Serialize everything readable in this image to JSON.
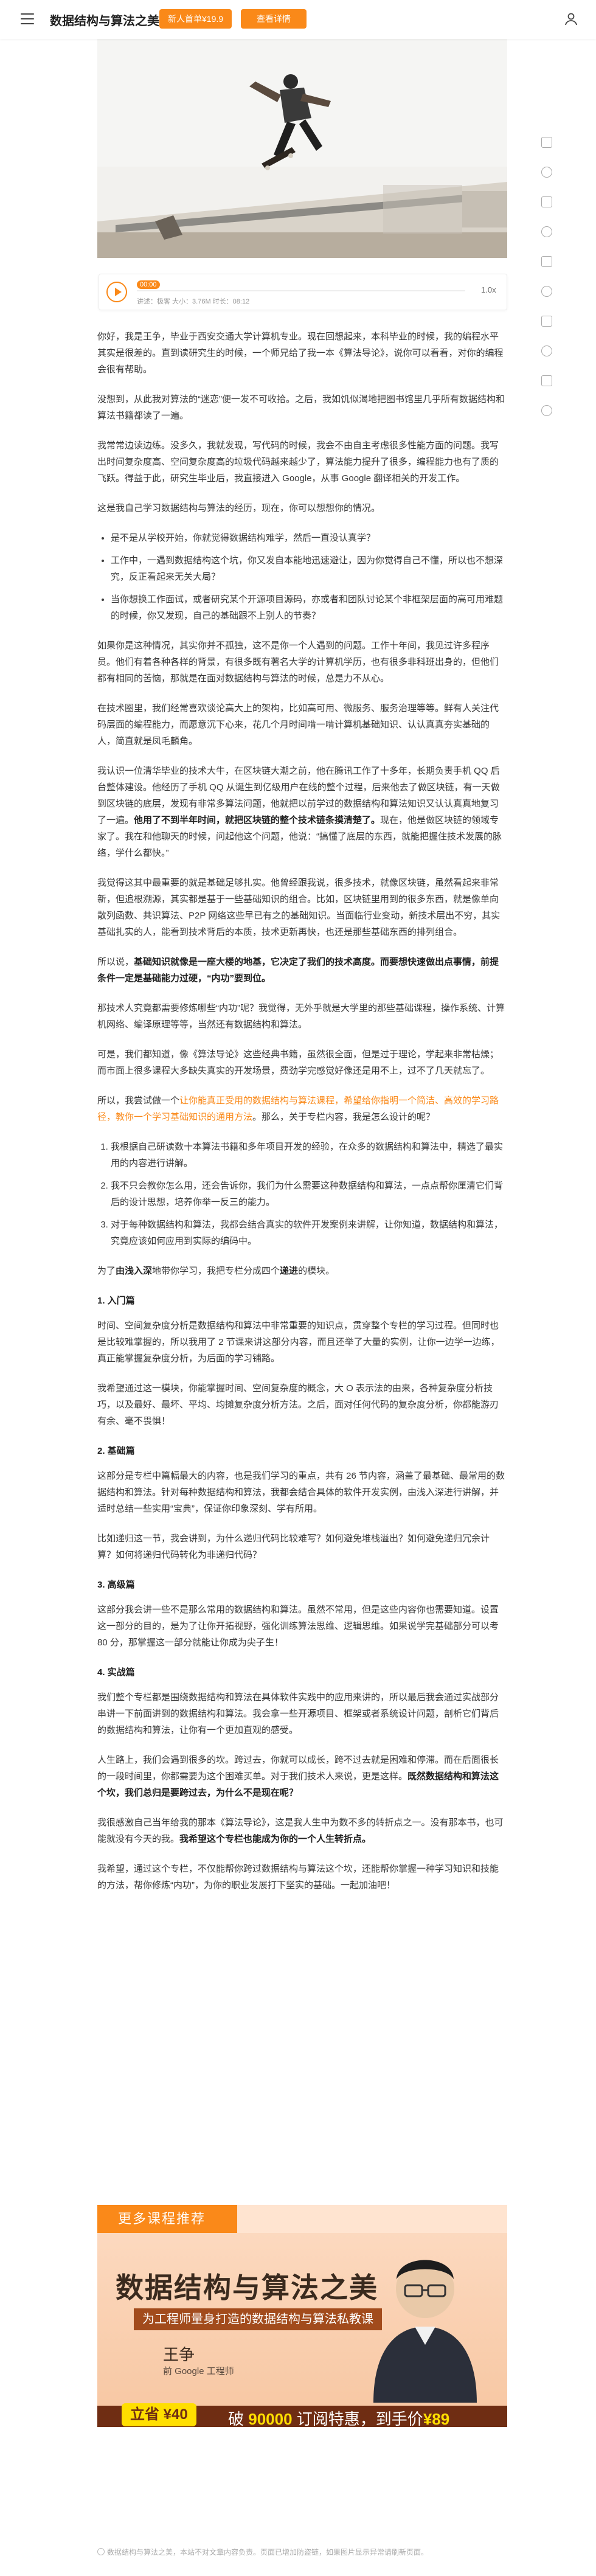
{
  "topbar": {
    "title": "数据结构与算法之美",
    "promo_badge": "新人首单¥19.9",
    "detail_button": "查看详情"
  },
  "audio": {
    "time_badge": "00:00",
    "meta": "讲述：极客  大小：3.76M  时长：08:12",
    "speed": "1.0x"
  },
  "article": {
    "p1": "你好，我是王争，毕业于西安交通大学计算机专业。现在回想起来，本科毕业的时候，我的编程水平其实是很差的。直到读研究生的时候，一个师兄给了我一本《算法导论》，说你可以看看，对你的编程会很有帮助。",
    "p2": "没想到，从此我对算法的“迷恋”便一发不可收拾。之后，我如饥似渴地把图书馆里几乎所有数据结构和算法书籍都读了一遍。",
    "p3": "我常常边读边练。没多久，我就发现，写代码的时候，我会不由自主考虑很多性能方面的问题。我写出时间复杂度高、空间复杂度高的垃圾代码越来越少了，算法能力提升了很多，编程能力也有了质的飞跃。得益于此，研究生毕业后，我直接进入 Google，从事 Google 翻译相关的开发工作。",
    "p4": "这是我自己学习数据结构与算法的经历，现在，你可以想想你的情况。",
    "bullets": [
      "是不是从学校开始，你就觉得数据结构难学，然后一直没认真学？",
      "工作中，一遇到数据结构这个坑，你又发自本能地迅速避让，因为你觉得自己不懂，所以也不想深究，反正看起来无关大局？",
      "当你想换工作面试，或者研究某个开源项目源码，亦或者和团队讨论某个非框架层面的高可用难题的时候，你又发现，自己的基础跟不上别人的节奏？"
    ],
    "p5": "如果你是这种情况，其实你并不孤独，这不是你一个人遇到的问题。工作十年间，我见过许多程序员。他们有着各种各样的背景，有很多既有著名大学的计算机学历，也有很多非科班出身的，但他们都有相同的苦恼，那就是在面对数据结构与算法的时候，总是力不从心。",
    "p6": "在技术圈里，我们经常喜欢谈论高大上的架构，比如高可用、微服务、服务治理等等。鲜有人关注代码层面的编程能力，而愿意沉下心来，花几个月时间啃一啃计算机基础知识、认认真真夯实基础的人，简直就是凤毛麟角。",
    "p7a": "我认识一位清华毕业的技术大牛，在区块链大潮之前，他在腾讯工作了十多年，长期负责手机 QQ 后台整体建设。他经历了手机 QQ 从诞生到亿级用户在线的整个过程，后来他去了做区块链，有一天做到区块链的底层，发现有非常多算法问题，他就把以前学过的数据结构和算法知识又认认真真地复习了一遍。",
    "p7b": "他用了不到半年时间，就把区块链的整个技术链条摸清楚了。",
    "p7c": "现在，他是做区块链的领域专家了。我在和他聊天的时候，问起他这个问题，他说：“搞懂了底层的东西，就能把握住技术发展的脉络，学什么都快。”",
    "p8": "我觉得这其中最重要的就是基础足够扎实。他曾经跟我说，很多技术，就像区块链，虽然看起来非常新，但追根溯源，其实都是基于一些基础知识的组合。比如，区块链里用到的很多东西，就是像单向散列函数、共识算法、P2P 网络这些早已有之的基础知识。当面临行业变动，新技术层出不穷，其实基础扎实的人，能看到技术背后的本质，技术更新再快，也还是那些基础东西的排列组合。",
    "p9a": "所以说，",
    "p9b": "基础知识就像是一座大楼的地基，它决定了我们的技术高度。而要想快速做出点事情，前提条件一定是基础能力过硬，“内功”要到位。",
    "p10": "那技术人究竟都需要修炼哪些“内功”呢？我觉得，无外乎就是大学里的那些基础课程，操作系统、计算机网络、编译原理等等，当然还有数据结构和算法。",
    "p11": "可是，我们都知道，像《算法导论》这些经典书籍，虽然很全面，但是过于理论，学起来非常枯燥；而市面上很多课程大多缺失真实的开发场景，费劲学完感觉好像还是用不上，过不了几天就忘了。",
    "p12a": "所以，我尝试做一个",
    "p12b": "让你能真正受用的数据结构与算法课程，希望给你指明一个简洁、高效的学习路径，教你一个学习基础知识的通用方法",
    "p12c": "。那么，关于专栏内容，我是怎么设计的呢？",
    "numbered": [
      "我根据自己研读数十本算法书籍和多年项目开发的经验，在众多的数据结构和算法中，精选了最实用的内容进行讲解。",
      "我不只会教你怎么用，还会告诉你，我们为什么需要这种数据结构和算法，一点点帮你厘清它们背后的设计思想，培养你举一反三的能力。",
      "对于每种数据结构和算法，我都会结合真实的软件开发案例来讲解，让你知道，数据结构和算法，究竟应该如何应用到实际的编码中。"
    ],
    "p13a": "为了",
    "p13b": "由浅入深",
    "p13c": "地带你学习，我把专栏分成四个",
    "p13d": "递进",
    "p13e": "的模块。",
    "s1_title": "1. 入门篇",
    "s1_text": "时间、空间复杂度分析是数据结构和算法中非常重要的知识点，贯穿整个专栏的学习过程。但同时也是比较难掌握的，所以我用了 2 节课来讲这部分内容，而且还举了大量的实例，让你一边学一边练，真正能掌握复杂度分析，为后面的学习铺路。",
    "s1_text2": "我希望通过这一模块，你能掌握时间、空间复杂度的概念，大 O 表示法的由来，各种复杂度分析技巧，以及最好、最坏、平均、均摊复杂度分析方法。之后，面对任何代码的复杂度分析，你都能游刃有余、毫不畏惧！",
    "s2_title": "2. 基础篇",
    "s2_text": "这部分是专栏中篇幅最大的内容，也是我们学习的重点，共有 26 节内容，涵盖了最基础、最常用的数据结构和算法。针对每种数据结构和算法，我都会结合具体的软件开发实例，由浅入深进行讲解，并适时总结一些实用“宝典”，保证你印象深刻、学有所用。",
    "s2_text2": "比如递归这一节，我会讲到，为什么递归代码比较难写？如何避免堆栈溢出？如何避免递归冗余计算？如何将递归代码转化为非递归代码？",
    "s3_title": "3. 高级篇",
    "s3_text": "这部分我会讲一些不是那么常用的数据结构和算法。虽然不常用，但是这些内容你也需要知道。设置这一部分的目的，是为了让你开拓视野，强化训练算法思维、逻辑思维。如果说学完基础部分可以考 80 分，那掌握这一部分就能让你成为尖子生！",
    "s4_title": "4. 实战篇",
    "s4_text": "我们整个专栏都是围绕数据结构和算法在具体软件实践中的应用来讲的，所以最后我会通过实战部分串讲一下前面讲到的数据结构和算法。我会拿一些开源项目、框架或者系统设计问题，剖析它们背后的数据结构和算法，让你有一个更加直观的感受。",
    "p14a": "人生路上，我们会遇到很多的坎。跨过去，你就可以成长，跨不过去就是困难和停滞。而在后面很长的一段时间里，你都需要为这个困难买单。对于我们技术人来说，更是这样。",
    "p14b": "既然数据结构和算法这个坎，我们总归是要跨过去，为什么不是现在呢？",
    "p15a": "我很感激自己当年给我的那本《算法导论》，这是我人生中为数不多的转折点之一。没有那本书，也可能就没有今天的我。",
    "p15b": "我希望这个专栏也能成为你的一个人生转折点。",
    "p16": "我希望，通过这个专栏，不仅能帮你跨过数据结构与算法这个坎，还能帮你掌握一种学习知识和技能的方法，帮你修炼“内功”，为你的职业发展打下坚实的基础。一起加油吧！"
  },
  "promo": {
    "label": "更多课程推荐",
    "course_title": "数据结构与算法之美",
    "subtitle": "为工程师量身打造的数据结构与算法私教课",
    "teacher": "王争",
    "role": "前 Google 工程师",
    "buy_button": "立省 ¥40",
    "buy_text_a": "破",
    "buy_text_b": "90000",
    "buy_text_c": "订阅特惠，到手价",
    "buy_text_d": "¥89"
  },
  "footnote": "数据结构与算法之美，本站不对文章内容负责。页面已增加防盗链，如果图片显示异常请刷新页面。",
  "colors": {
    "accent": "#fa8919",
    "promo_dark": "#6f2d13"
  }
}
